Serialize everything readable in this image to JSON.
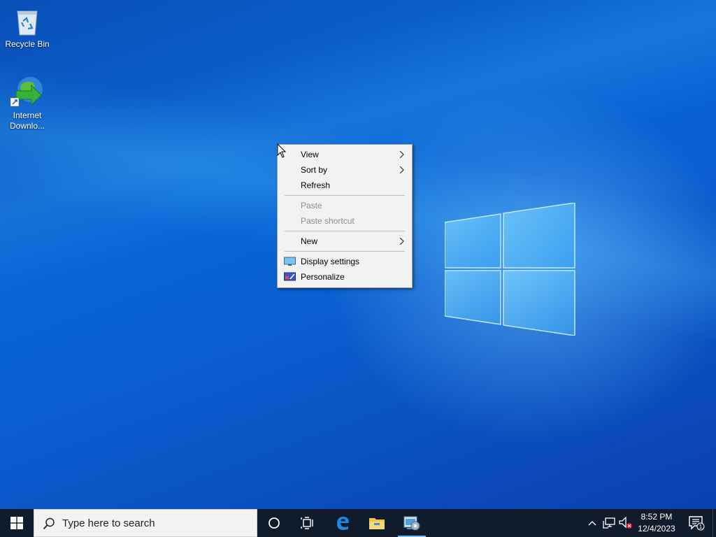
{
  "desktop": {
    "icons": [
      {
        "label": "Recycle Bin",
        "icon": "recycle-bin-icon"
      },
      {
        "label_line1": "Internet",
        "label_line2": "Downlo...",
        "icon": "internet-download-manager-icon"
      }
    ]
  },
  "context_menu": {
    "view": "View",
    "sort_by": "Sort by",
    "refresh": "Refresh",
    "paste": "Paste",
    "paste_shortcut": "Paste shortcut",
    "new": "New",
    "display_settings": "Display settings",
    "personalize": "Personalize"
  },
  "taskbar": {
    "search_placeholder": "Type here to search",
    "time": "8:52 PM",
    "date": "12/4/2023",
    "notification_count": "1",
    "pinned": [
      "start-icon",
      "cortana-icon",
      "task-view-icon",
      "edge-icon",
      "file-explorer-icon",
      "control-panel-icon"
    ]
  },
  "colors": {
    "taskbar_bg": "#101c2c",
    "menu_bg": "#f2f2f2",
    "accent": "#76b9ed"
  }
}
